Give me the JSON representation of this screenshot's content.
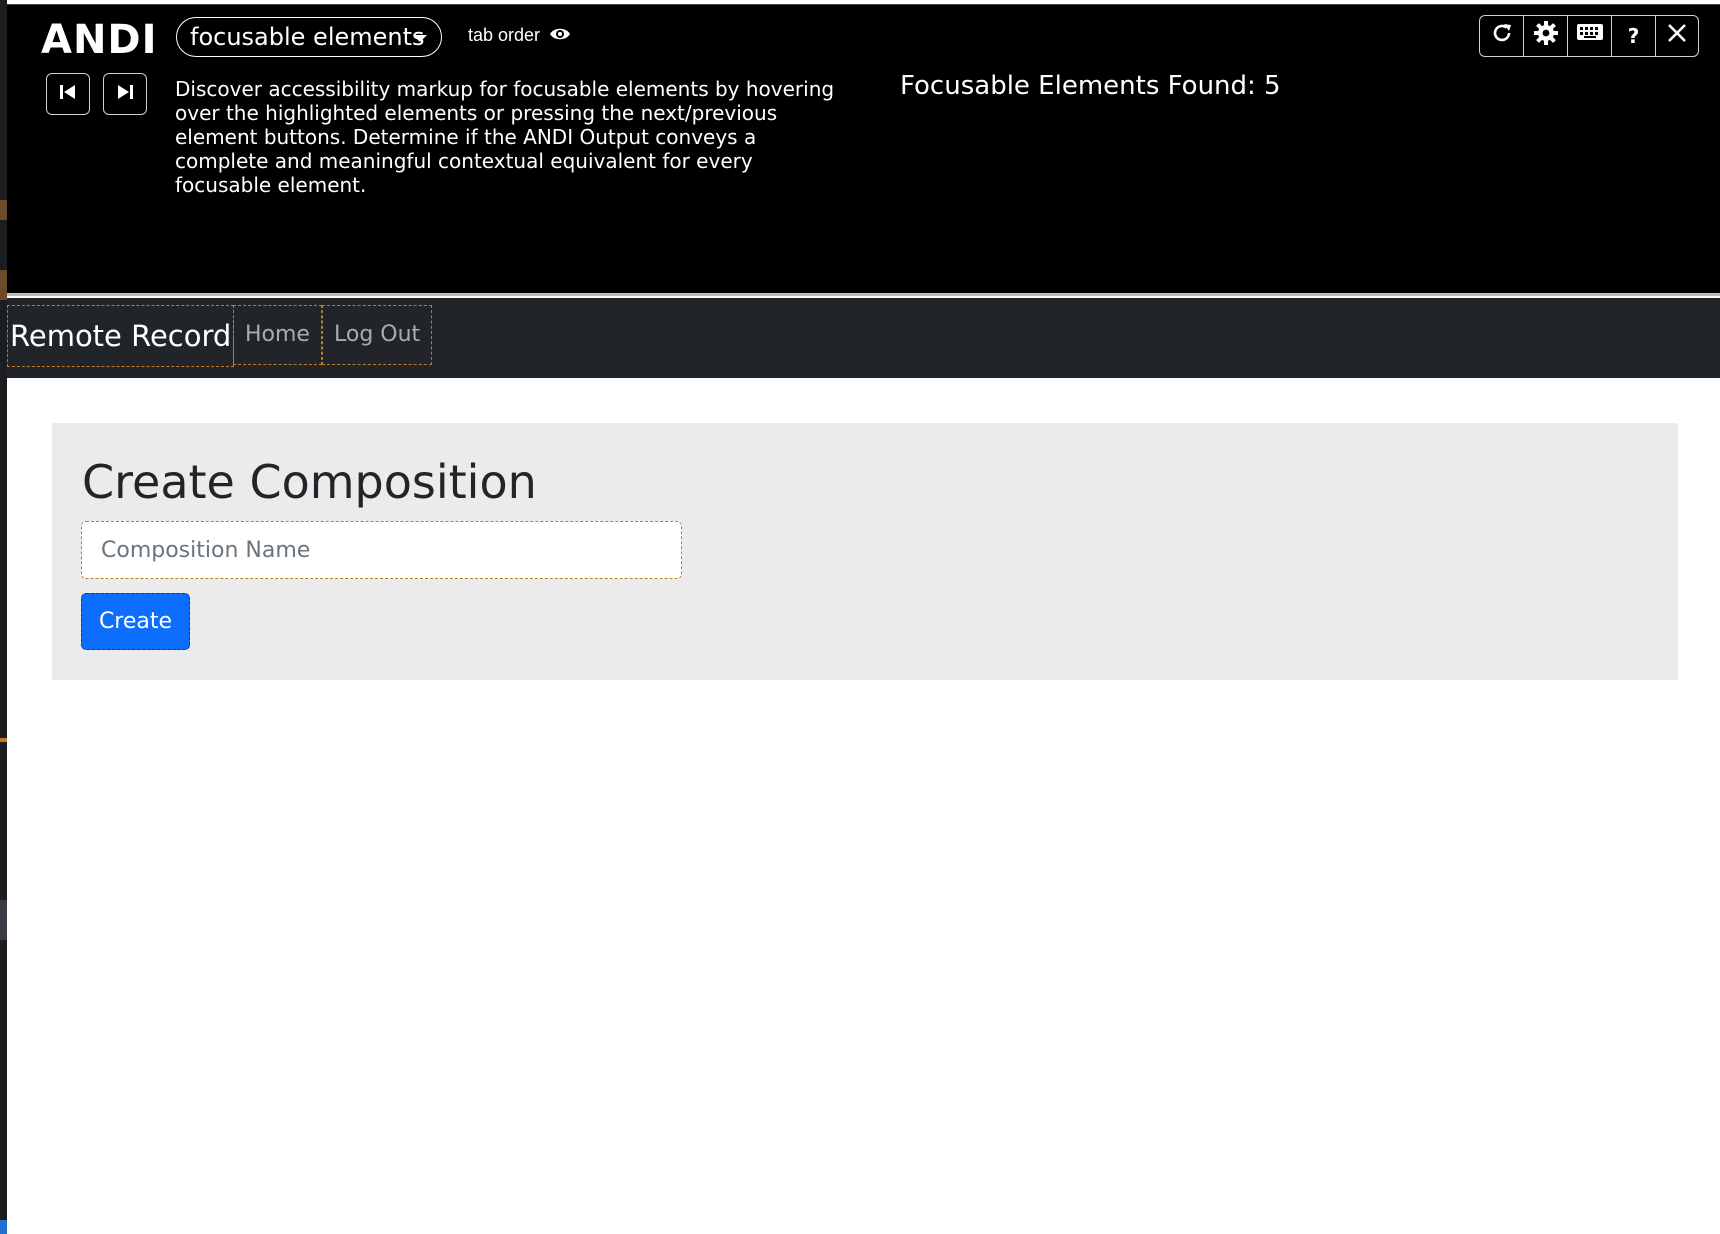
{
  "andi": {
    "logo": "ANDI",
    "module_label": "focusable elements",
    "tab_order_label": "tab order",
    "description": "Discover accessibility markup for focusable elements by hovering over the highlighted elements or pressing the next/previous element buttons. Determine if the ANDI Output conveys a complete and meaningful contextual equivalent for every focusable element.",
    "found_text": "Focusable Elements Found: 5",
    "help_label": "?",
    "icons": [
      "refresh-icon",
      "gear-icon",
      "keyboard-icon",
      "help-icon",
      "close-icon",
      "prev-element-icon",
      "next-element-icon",
      "eye-icon"
    ]
  },
  "navbar": {
    "brand": "Remote Record",
    "links": [
      {
        "label": "Home"
      },
      {
        "label": "Log Out"
      }
    ]
  },
  "main": {
    "title": "Create Composition",
    "input_placeholder": "Composition Name",
    "input_value": "",
    "create_label": "Create"
  },
  "colors": {
    "andi_bg": "#000000",
    "navbar_bg": "#212529",
    "card_bg": "#ebebeb",
    "primary": "#0d6efd",
    "highlight_outline": "#c07a28"
  }
}
